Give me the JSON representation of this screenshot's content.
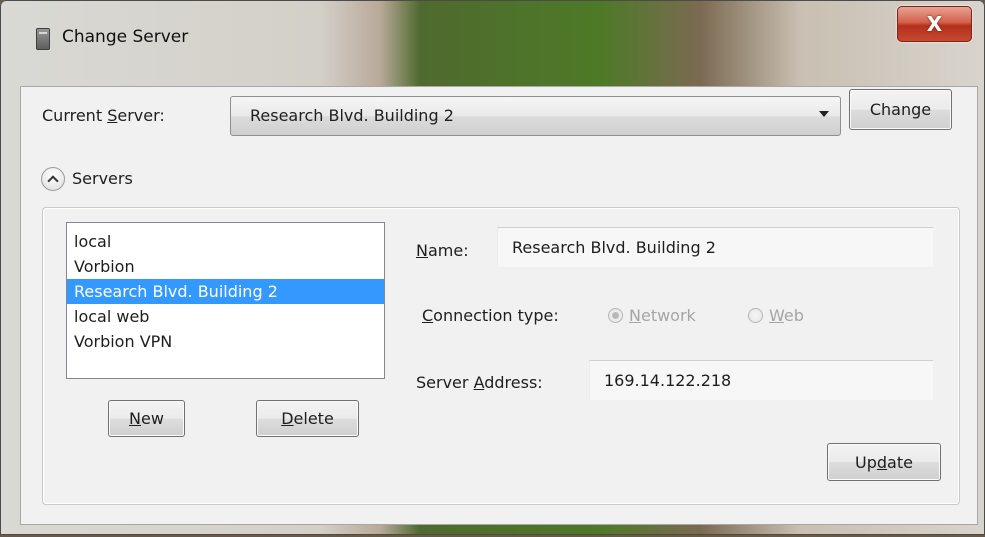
{
  "window": {
    "title": "Change Server",
    "close_glyph": "X"
  },
  "current_server": {
    "label_pre": "Current ",
    "label_accel": "S",
    "label_post": "erver:",
    "value": "Research Blvd. Building 2",
    "change_label": "Change"
  },
  "servers_section": {
    "label": "Servers",
    "list": [
      {
        "label": "local"
      },
      {
        "label": "Vorbion"
      },
      {
        "label": "Research Blvd. Building 2",
        "selected": true
      },
      {
        "label": "local web"
      },
      {
        "label": "Vorbion VPN"
      }
    ],
    "new_accel": "N",
    "new_rest": "ew",
    "delete_accel": "D",
    "delete_rest": "elete"
  },
  "details": {
    "name_accel": "N",
    "name_rest": "ame:",
    "name_value": "Research Blvd. Building 2",
    "connection_accel": "C",
    "connection_rest": "onnection type:",
    "network_accel": "N",
    "network_rest": "etwork",
    "web_accel": "W",
    "web_rest": "eb",
    "address_pre": "Server ",
    "address_accel": "A",
    "address_post": "ddress:",
    "address_value": "169.14.122.218",
    "update_pre": "Up",
    "update_accel": "d",
    "update_post": "ate"
  },
  "icons": {
    "app": "server-app-icon",
    "expander": "chevron-up-icon",
    "dropdown": "chevron-down-icon"
  },
  "colors": {
    "selection": "#3399ff",
    "close_button": "#c84a32"
  }
}
